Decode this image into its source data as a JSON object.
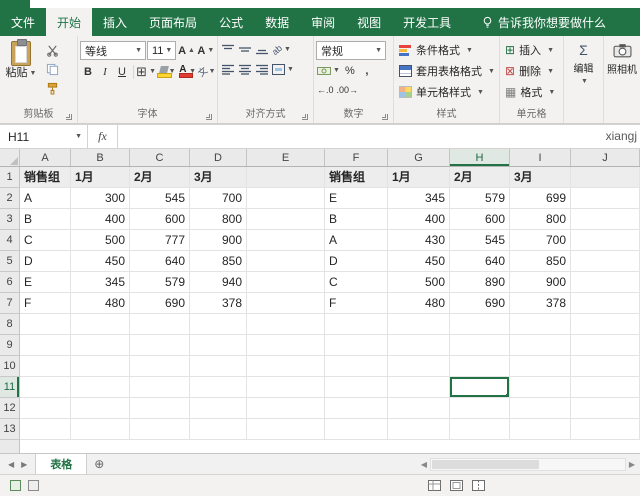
{
  "app": {
    "name": "Excel"
  },
  "tabs": [
    "文件",
    "开始",
    "插入",
    "页面布局",
    "公式",
    "数据",
    "审阅",
    "视图",
    "开发工具"
  ],
  "active_tab": "开始",
  "tell_me": "告诉我你想要做什么",
  "ribbon": {
    "clipboard": {
      "paste": "粘贴",
      "label": "剪贴板"
    },
    "font": {
      "name": "等线",
      "size": "11",
      "bold": "B",
      "italic": "I",
      "underline": "U",
      "label": "字体"
    },
    "alignment": {
      "label": "对齐方式"
    },
    "number": {
      "format": "常规",
      "percent": "%",
      "comma": ",",
      "label": "数字"
    },
    "styles": {
      "conditional_formatting": "条件格式",
      "format_as_table": "套用表格格式",
      "cell_styles": "单元格样式",
      "label": "样式"
    },
    "cells": {
      "insert": "插入",
      "delete": "删除",
      "format": "格式",
      "label": "单元格"
    },
    "editing": {
      "label": "编辑"
    },
    "camera": {
      "label": "照相机"
    }
  },
  "formula_bar": {
    "name_box": "H11",
    "fx_label": "fx",
    "value": ""
  },
  "overlay_text": "xiangj",
  "grid": {
    "columns": [
      "A",
      "B",
      "C",
      "D",
      "E",
      "F",
      "G",
      "H",
      "I",
      "J"
    ],
    "selection": {
      "ref": "H11",
      "col": "H",
      "row": 11
    },
    "rows": [
      {
        "num": 1,
        "cells": [
          "销售组",
          "1月",
          "2月",
          "3月",
          "",
          "销售组",
          "1月",
          "2月",
          "3月",
          ""
        ]
      },
      {
        "num": 2,
        "cells": [
          "A",
          "300",
          "545",
          "700",
          "",
          "E",
          "345",
          "579",
          "699",
          ""
        ]
      },
      {
        "num": 3,
        "cells": [
          "B",
          "400",
          "600",
          "800",
          "",
          "B",
          "400",
          "600",
          "800",
          ""
        ]
      },
      {
        "num": 4,
        "cells": [
          "C",
          "500",
          "777",
          "900",
          "",
          "A",
          "430",
          "545",
          "700",
          ""
        ]
      },
      {
        "num": 5,
        "cells": [
          "D",
          "450",
          "640",
          "850",
          "",
          "D",
          "450",
          "640",
          "850",
          ""
        ]
      },
      {
        "num": 6,
        "cells": [
          "E",
          "345",
          "579",
          "940",
          "",
          "C",
          "500",
          "890",
          "900",
          ""
        ]
      },
      {
        "num": 7,
        "cells": [
          "F",
          "480",
          "690",
          "378",
          "",
          "F",
          "480",
          "690",
          "378",
          ""
        ]
      },
      {
        "num": 8,
        "cells": [
          "",
          "",
          "",
          "",
          "",
          "",
          "",
          "",
          "",
          ""
        ]
      },
      {
        "num": 9,
        "cells": [
          "",
          "",
          "",
          "",
          "",
          "",
          "",
          "",
          "",
          ""
        ]
      },
      {
        "num": 10,
        "cells": [
          "",
          "",
          "",
          "",
          "",
          "",
          "",
          "",
          "",
          ""
        ]
      },
      {
        "num": 11,
        "cells": [
          "",
          "",
          "",
          "",
          "",
          "",
          "",
          "",
          "",
          ""
        ]
      },
      {
        "num": 12,
        "cells": [
          "",
          "",
          "",
          "",
          "",
          "",
          "",
          "",
          "",
          ""
        ]
      },
      {
        "num": 13,
        "cells": [
          "",
          "",
          "",
          "",
          "",
          "",
          "",
          "",
          "",
          ""
        ]
      }
    ]
  },
  "sheet_tabs": {
    "tabs": [
      "表格"
    ],
    "active": "表格"
  },
  "colors": {
    "accent_green": "#217346"
  }
}
